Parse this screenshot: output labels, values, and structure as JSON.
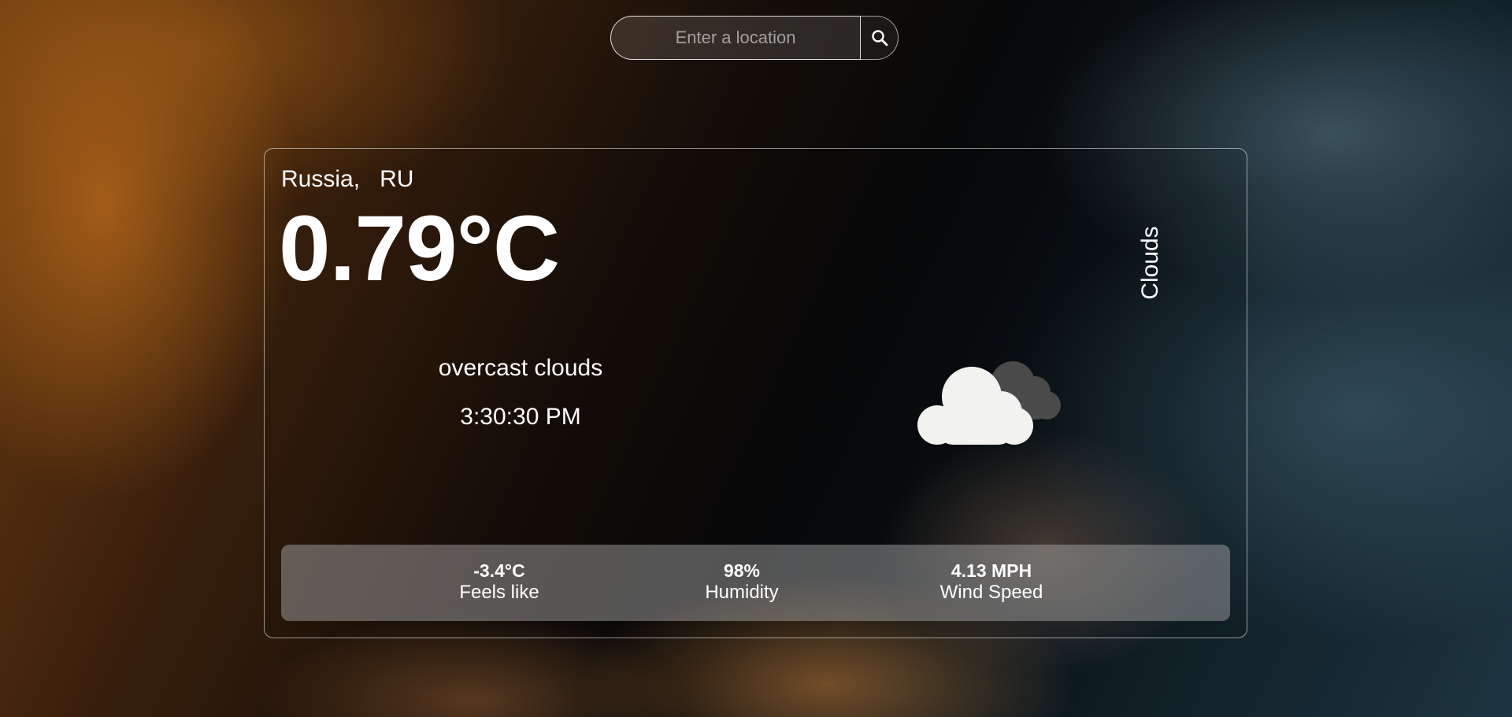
{
  "search": {
    "placeholder": "Enter a location",
    "value": "",
    "button_icon": "search-icon"
  },
  "weather": {
    "city": "Russia,",
    "country": "RU",
    "temperature": "0.79°C",
    "description": "overcast clouds",
    "time": "3:30:30 PM",
    "condition": "Clouds",
    "icon": "cloud-icon"
  },
  "stats": {
    "feels_like": {
      "value": "-3.4°C",
      "label": "Feels like"
    },
    "humidity": {
      "value": "98%",
      "label": "Humidity"
    },
    "wind_speed": {
      "value": "4.13 MPH",
      "label": "Wind Speed"
    }
  },
  "colors": {
    "text": "#ffffff",
    "panel": "#8a8a8a",
    "cloud_front": "#f2f2f0",
    "cloud_back": "#4a4a4a"
  }
}
